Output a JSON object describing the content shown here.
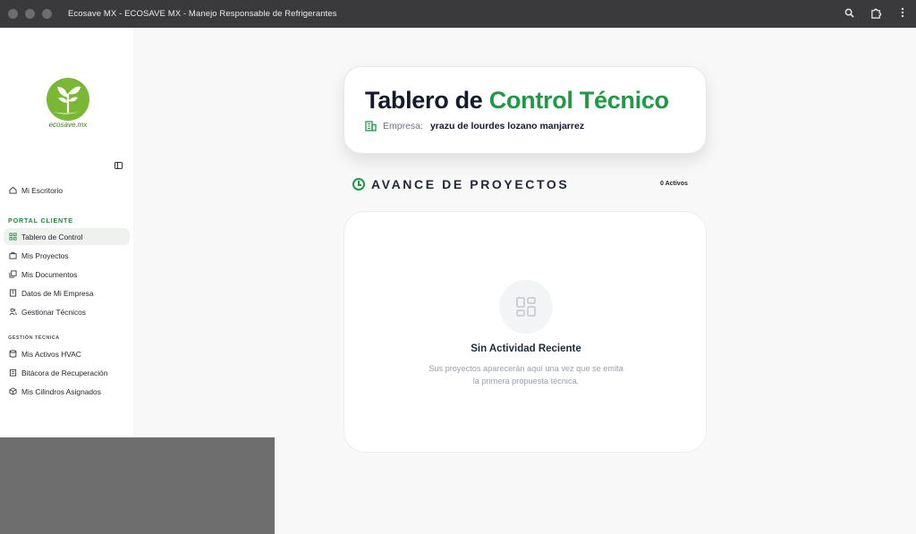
{
  "window": {
    "title": "Ecosave MX - ECOSAVE MX - Manejo Responsable de Refrigerantes"
  },
  "brand": {
    "logo_text": "ecosave.mx",
    "accent": "#1e9a45"
  },
  "sidebar": {
    "top_item": {
      "label": "Mi Escritorio",
      "icon": "home-icon"
    },
    "section1_label": "PORTAL CLIENTE",
    "section1_items": [
      {
        "label": "Tablero de Control",
        "icon": "grid-icon",
        "active": true
      },
      {
        "label": "Mis Proyectos",
        "icon": "briefcase-icon"
      },
      {
        "label": "Mis Documentos",
        "icon": "documents-icon"
      },
      {
        "label": "Datos de Mi Empresa",
        "icon": "building-icon"
      },
      {
        "label": "Gestionar Técnicos",
        "icon": "users-icon"
      }
    ],
    "section2_label": "GESTIÓN TÉCNICA",
    "section2_items": [
      {
        "label": "Mis Activos HVAC",
        "icon": "database-icon"
      },
      {
        "label": "Bitácora de Recuperación",
        "icon": "clipboard-icon"
      },
      {
        "label": "Mis Cilindros Asignados",
        "icon": "box-icon"
      }
    ]
  },
  "header": {
    "title_part1": "Tablero de ",
    "title_part2": "Control Técnico",
    "company_label": "Empresa:",
    "company_name": "yrazu de lourdes lozano manjarrez"
  },
  "progress": {
    "title": "AVANCE DE PROYECTOS",
    "active_count": "0 Activos"
  },
  "empty_state": {
    "title": "Sin Actividad Reciente",
    "description": "Sus proyectos aparecerán aquí una vez que se emita la primera propuesta técnica."
  }
}
